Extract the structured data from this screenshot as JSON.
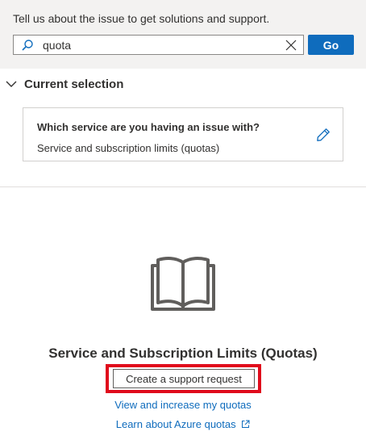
{
  "search": {
    "prompt": "Tell us about the issue to get solutions and support.",
    "value": "quota",
    "go_label": "Go"
  },
  "current_selection": {
    "header": "Current selection",
    "question": "Which service are you having an issue with?",
    "answer": "Service and subscription limits (quotas)"
  },
  "result": {
    "title": "Service and Subscription Limits (Quotas)",
    "create_button": "Create a support request",
    "link_view": "View and increase my quotas",
    "link_learn": "Learn about Azure quotas"
  },
  "icons": {
    "search": "search-icon",
    "clear": "close-icon",
    "collapse": "chevron-down-icon",
    "edit": "pencil-icon",
    "book": "book-icon",
    "external": "external-link-icon"
  },
  "colors": {
    "accent": "#0f6cbd",
    "highlight": "#e00b1c",
    "top_bg": "#f3f2f1"
  }
}
